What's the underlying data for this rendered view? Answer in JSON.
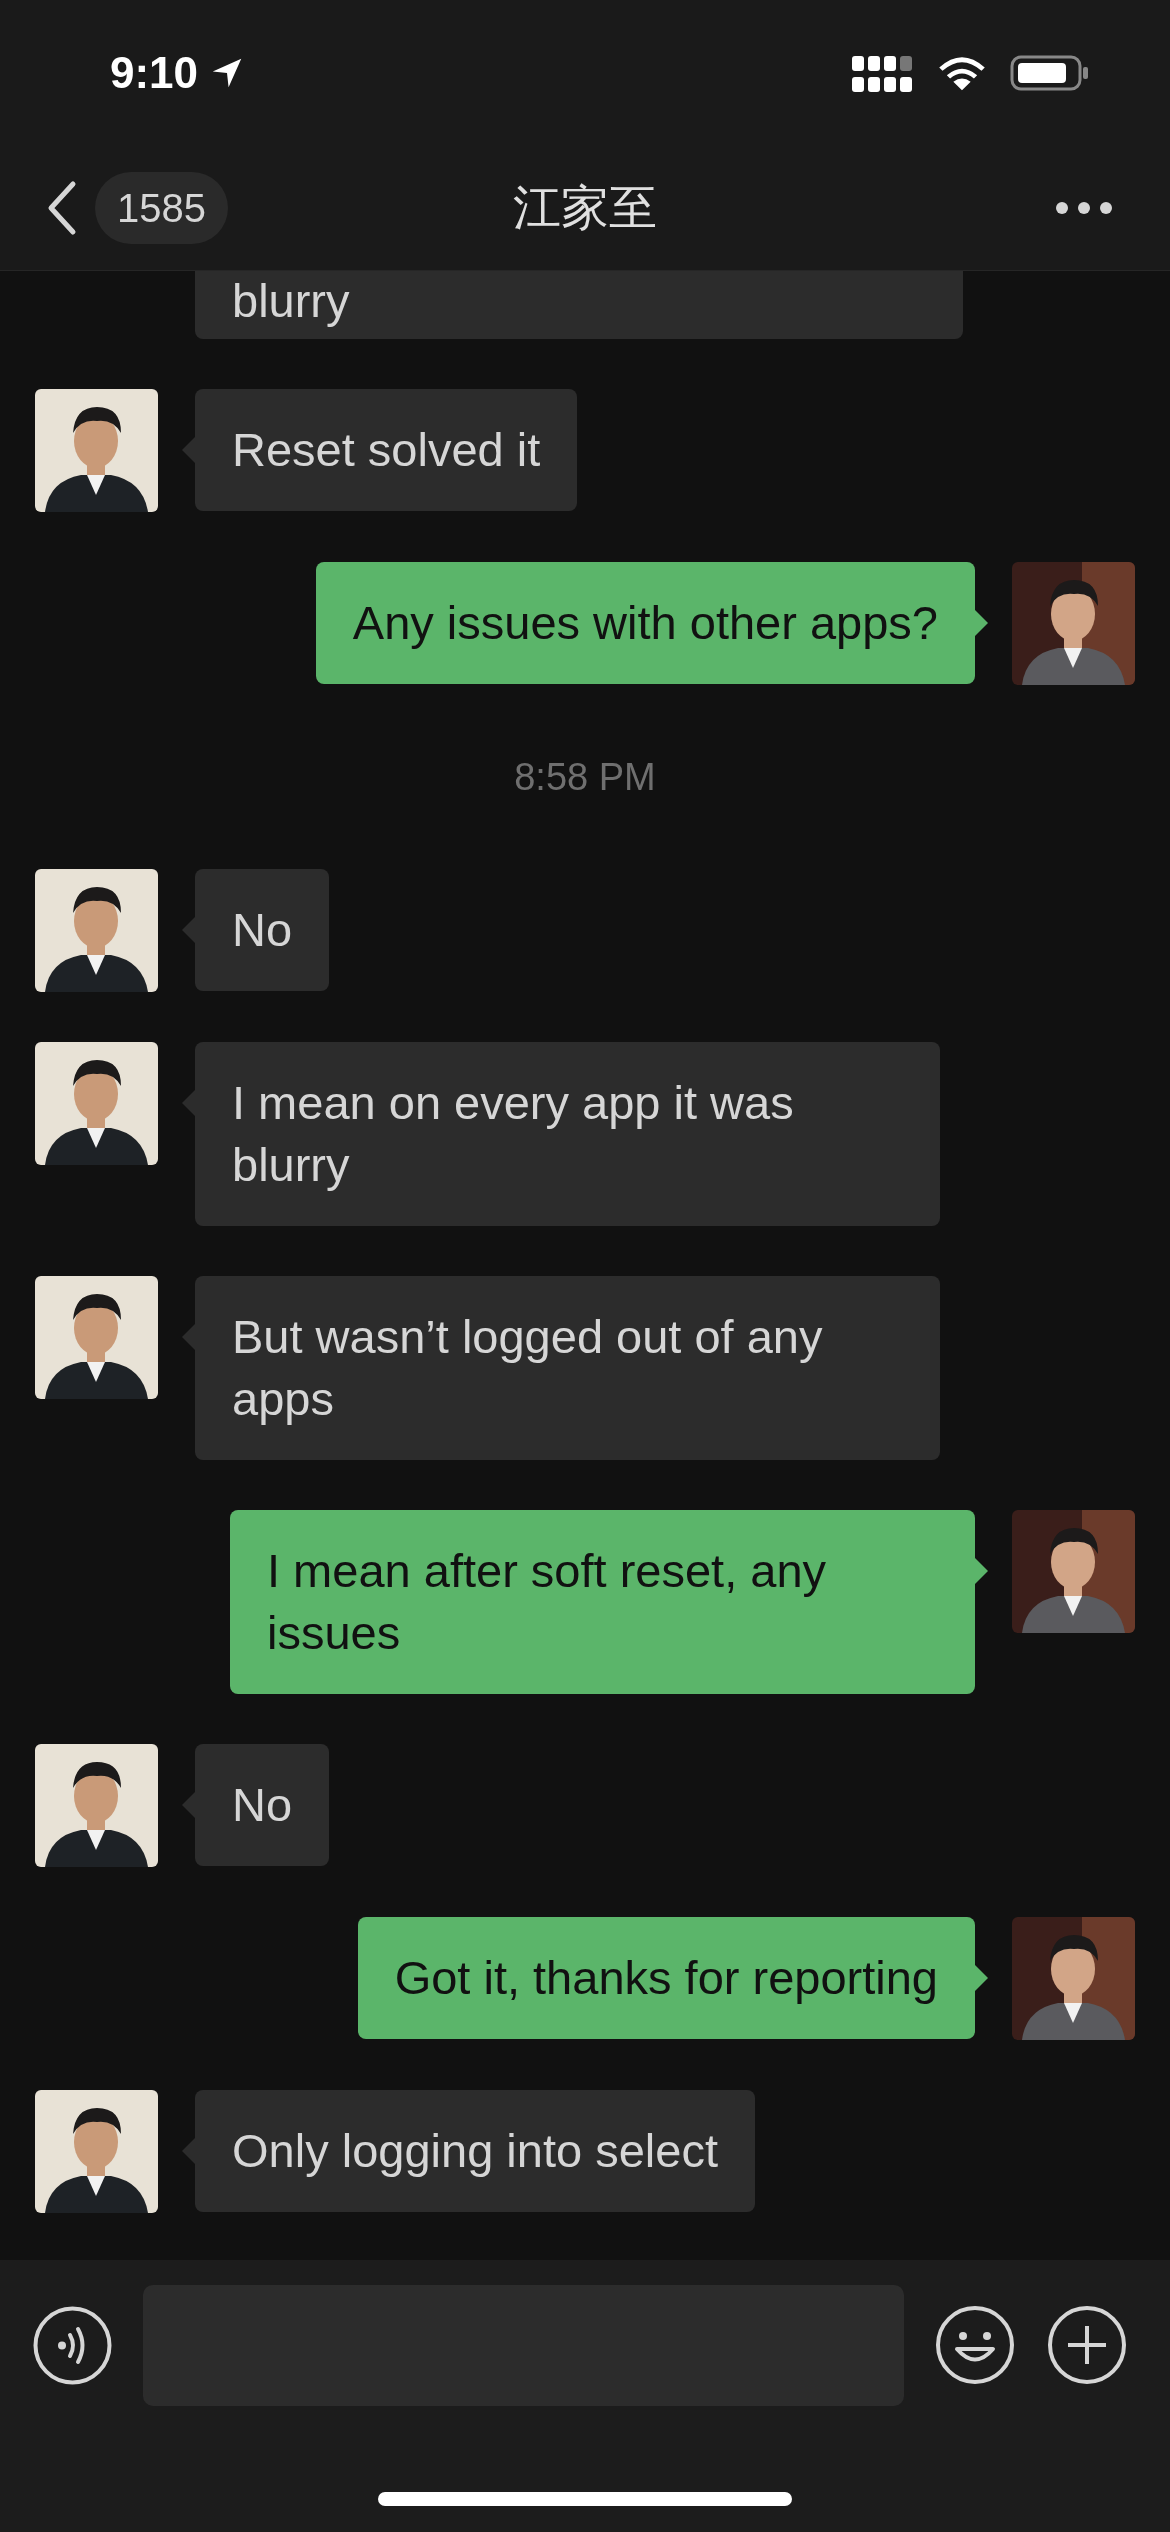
{
  "status_bar": {
    "time": "9:10"
  },
  "nav": {
    "back_count": "1585",
    "title": "江家至"
  },
  "messages": [
    {
      "kind": "message",
      "outgoing": false,
      "text": "blurry",
      "partial": true
    },
    {
      "kind": "message",
      "outgoing": false,
      "text": "Reset solved it"
    },
    {
      "kind": "message",
      "outgoing": true,
      "text": "Any issues with other apps?"
    },
    {
      "kind": "time",
      "text": "8:58 PM"
    },
    {
      "kind": "message",
      "outgoing": false,
      "text": "No"
    },
    {
      "kind": "message",
      "outgoing": false,
      "text": "I mean on every app it was blurry"
    },
    {
      "kind": "message",
      "outgoing": false,
      "text": "But wasn’t logged out of any apps"
    },
    {
      "kind": "message",
      "outgoing": true,
      "text": "I mean after soft reset, any issues"
    },
    {
      "kind": "message",
      "outgoing": false,
      "text": "No"
    },
    {
      "kind": "message",
      "outgoing": true,
      "text": "Got it, thanks for reporting"
    },
    {
      "kind": "message",
      "outgoing": false,
      "text": "Only logging into select"
    }
  ]
}
